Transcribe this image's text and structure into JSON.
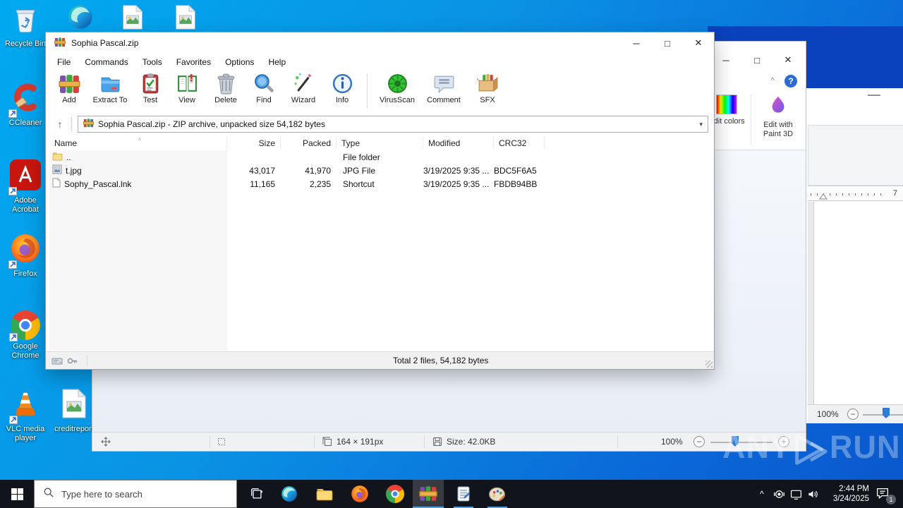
{
  "colors": {
    "desktop_top": "#00a9f0",
    "desktop_bottom": "#0a57cc",
    "wordpad_titlebar": "#0a41bd",
    "taskbar_bg": "#11151b",
    "taskbar_underline": "#55a0e4",
    "paint_help_circle": "#2b6cd4",
    "zoom_thumb": "#2e7cd6"
  },
  "icons": {
    "minimize": "─",
    "maximize": "□",
    "close": "✕",
    "up_arrow": "↑",
    "dropdown": "▾",
    "sort_asc": "▵",
    "ribbon_collapse": "^",
    "help": "?",
    "zoom_out": "−",
    "zoom_in": "+",
    "tray_chevron": "^"
  },
  "desktop": {
    "icons": [
      {
        "label": "Recycle Bin",
        "icon": "recycle-bin"
      },
      {
        "label": "CCleaner",
        "icon": "ccleaner"
      },
      {
        "label": "Adobe Acrobat",
        "icon": "adobe-acrobat"
      },
      {
        "label": "Firefox",
        "icon": "firefox"
      },
      {
        "label": "Google Chrome",
        "icon": "google-chrome"
      },
      {
        "label": "VLC media player",
        "icon": "vlc-cone"
      },
      {
        "label": "creditreport",
        "icon": "image-file"
      },
      {
        "label": "",
        "icon": "edge"
      },
      {
        "label": "",
        "icon": "image-file"
      },
      {
        "label": "",
        "icon": "image-file"
      }
    ],
    "watermark": {
      "left": "ANY",
      "right": "RUN"
    }
  },
  "winrar": {
    "title": "Sophia Pascal.zip",
    "menu": [
      "File",
      "Commands",
      "Tools",
      "Favorites",
      "Options",
      "Help"
    ],
    "toolbar": [
      {
        "label": "Add",
        "icon": "add-archive-icon"
      },
      {
        "label": "Extract To",
        "icon": "extract-folder-icon"
      },
      {
        "label": "Test",
        "icon": "test-clipboard-icon"
      },
      {
        "label": "View",
        "icon": "view-book-icon"
      },
      {
        "label": "Delete",
        "icon": "trash-icon"
      },
      {
        "label": "Find",
        "icon": "find-magnifier-icon"
      },
      {
        "label": "Wizard",
        "icon": "wizard-wand-icon"
      },
      {
        "label": "Info",
        "icon": "info-icon"
      },
      {
        "label": "VirusScan",
        "icon": "virus-scan-icon"
      },
      {
        "label": "Comment",
        "icon": "comment-bubble-icon"
      },
      {
        "label": "SFX",
        "icon": "sfx-box-icon"
      }
    ],
    "address": "Sophia Pascal.zip - ZIP archive, unpacked size 54,182 bytes",
    "columns": [
      "Name",
      "Size",
      "Packed",
      "Type",
      "Modified",
      "CRC32"
    ],
    "rows": [
      {
        "name": "..",
        "size": "",
        "packed": "",
        "type": "File folder",
        "modified": "",
        "crc32": ""
      },
      {
        "name": "t.jpg",
        "size": "43,017",
        "packed": "41,970",
        "type": "JPG File",
        "modified": "3/19/2025 9:35 ...",
        "crc32": "BDC5F6A5"
      },
      {
        "name": "Sophy_Pascal.lnk",
        "size": "11,165",
        "packed": "2,235",
        "type": "Shortcut",
        "modified": "3/19/2025 9:35 ...",
        "crc32": "FBDB94BB"
      }
    ],
    "status_total": "Total 2 files, 54,182 bytes"
  },
  "paint": {
    "edit_colors_label": "Edit colors",
    "edit_paint3d_label": "Edit with Paint 3D",
    "status": {
      "dimensions": "164 × 191px",
      "file_size": "Size: 42.0KB",
      "zoom_level": "100%"
    }
  },
  "wordpad": {
    "ruler_mark": "7",
    "zoom_level": "100%"
  },
  "taskbar": {
    "search_placeholder": "Type here to search",
    "clock_time": "2:44 PM",
    "clock_date": "3/24/2025",
    "notification_badge": "1"
  }
}
